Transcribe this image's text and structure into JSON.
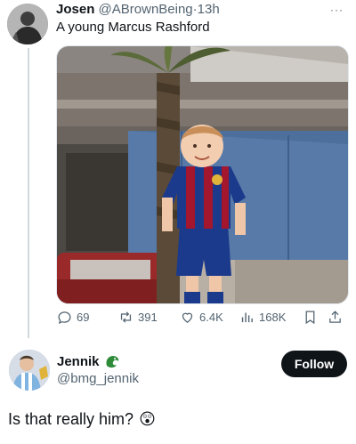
{
  "tweet": {
    "author_name": "Josen",
    "handle": "@ABrownBeing",
    "separator": "·",
    "time": "13h",
    "more": "···",
    "text": "A young Marcus Rashford",
    "actions": {
      "replies": "69",
      "retweets": "391",
      "likes": "6.4K",
      "views": "168K"
    }
  },
  "reply_user": {
    "name": "Jennik",
    "badge_icon": "dragon-icon",
    "handle": "@bmg_jennik",
    "follow_label": "Follow",
    "text": "Is that really him?",
    "emoji": "😲"
  },
  "colors": {
    "text": "#0f1419",
    "muted": "#536471",
    "follow_bg": "#0f1419",
    "barca_blue": "#1c3a8c",
    "barca_red": "#a3162e"
  }
}
